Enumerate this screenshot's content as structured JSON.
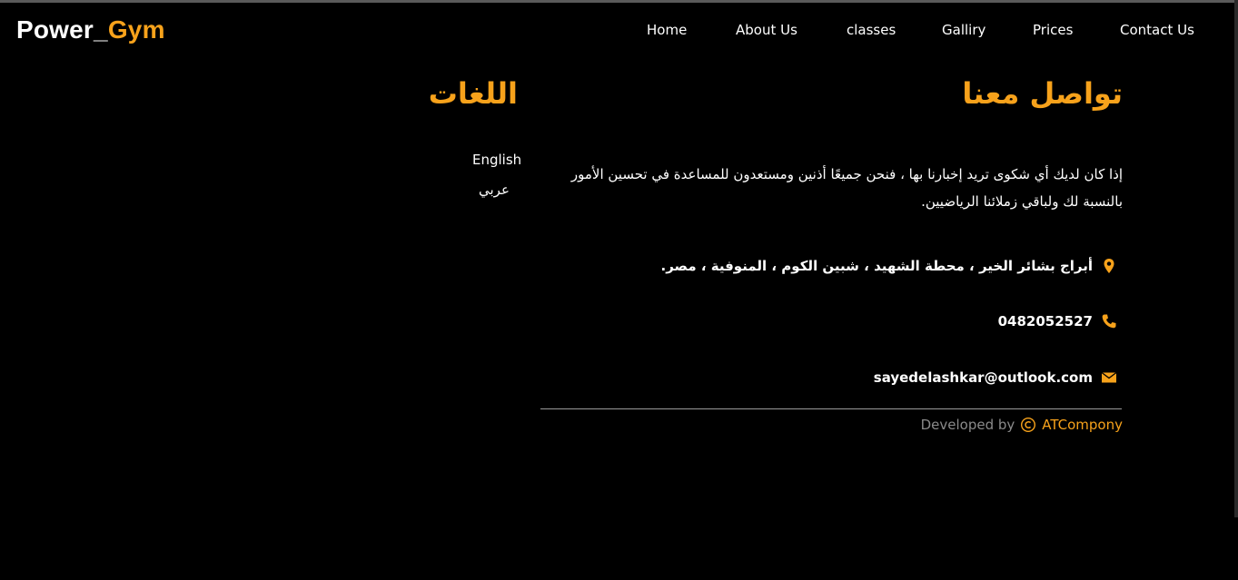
{
  "brand": {
    "part1": "Power_",
    "part2": "Gym"
  },
  "nav": [
    {
      "label": "Home"
    },
    {
      "label": "About Us"
    },
    {
      "label": "classes"
    },
    {
      "label": "Galliry"
    },
    {
      "label": "Prices"
    },
    {
      "label": "Contact Us"
    }
  ],
  "contact": {
    "heading": "تواصل معنا",
    "description": "إذا كان لديك أي شكوى تريد إخبارنا بها ، فنحن جميعًا أذنين ومستعدون للمساعدة في تحسين الأمور بالنسبة لك ولباقي زملائنا الرياضيين.",
    "address": "أبراج بشائر الخير ، محطة الشهيد ، شبين الكوم ، المنوفية ، مصر.",
    "phone": "0482052527",
    "email": "sayedelashkar@outlook.com"
  },
  "languages": {
    "heading": "اللغات",
    "items": [
      "English",
      "عربي"
    ]
  },
  "footer": {
    "developed_by": "Developed by",
    "company": "ATCompony"
  },
  "colors": {
    "accent": "#f7a21b",
    "background": "#000000",
    "text": "#ffffff"
  },
  "icons": {
    "address": "map-marker-icon",
    "phone": "phone-icon",
    "email": "envelope-icon",
    "footer": "copyright-icon"
  }
}
